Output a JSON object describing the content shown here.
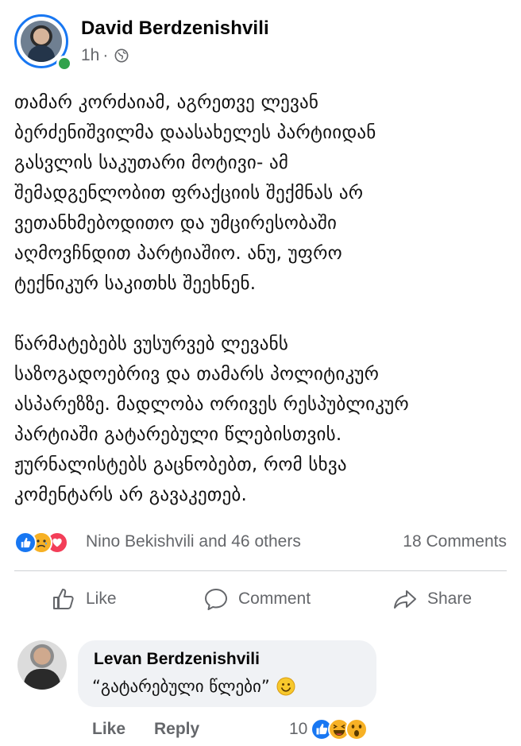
{
  "post": {
    "author": "David Berdzenishvili",
    "time": "1h",
    "separator": "·",
    "privacy_icon": "globe-icon",
    "paragraphs": [
      [
        "თამარ კორძაიამ, აგრეთვე  ლევან",
        "ბერძენიშვილმა დაასახელეს პარტიიდან",
        "გასვლის საკუთარი მოტივი- ამ",
        "შემადგენლობით ფრაქციის შექმნას არ",
        "ვეთანხმებოდითო და უმცირესობაში",
        "აღმოვჩნდით პარტიაშიო. ანუ, უფრო",
        "ტექნიკურ საკითხს შეეხნენ."
      ],
      [
        "წარმატებებს ვუსურვებ ლევანს",
        "საზოგადოებრივ და თამარს პოლიტიკურ",
        "ასპარეზზე. მადლობა ორივეს რესპუბლიკურ",
        "პარტიაში გატარებული წლებისთვის.",
        "ჟურნალისტებს გაცნობებთ, რომ სხვა",
        "კომენტარს არ გავაკეთებ."
      ]
    ]
  },
  "reactions": {
    "icons": [
      "like-icon",
      "sad-icon",
      "love-icon"
    ],
    "summary": "Nino Bekishvili and 46 others",
    "comments": "18 Comments"
  },
  "actions": {
    "like": "Like",
    "comment": "Comment",
    "share": "Share"
  },
  "comment": {
    "author": "Levan Berdzenishvili",
    "text": "“გატარებული წლები”",
    "emoji_icon": "smile-icon",
    "like_label": "Like",
    "reply_label": "Reply",
    "reaction_count": "10",
    "reaction_icons": [
      "like-icon",
      "haha-icon",
      "wow-icon"
    ]
  },
  "colors": {
    "facebook_blue": "#1877f2",
    "muted_text": "#65676b",
    "bubble_bg": "#f0f2f5",
    "online_green": "#31a24c",
    "love_red": "#f33e58",
    "reaction_yellow": "#f7b125"
  }
}
